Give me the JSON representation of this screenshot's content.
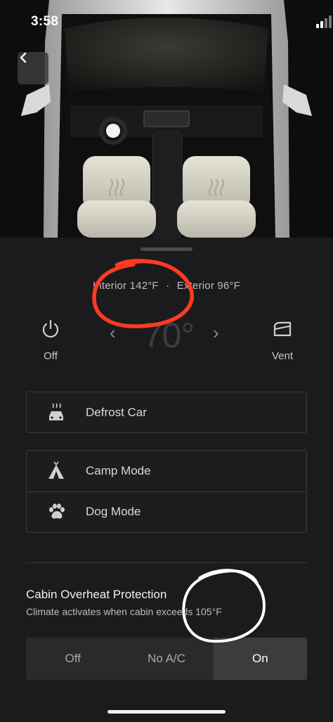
{
  "status": {
    "time": "3:58"
  },
  "nav": {
    "back_icon": "chevron-left-icon"
  },
  "climate": {
    "interior": "Interior 142°F",
    "separator": "·",
    "exterior": "Exterior 96°F",
    "setpoint": "70°",
    "power_label": "Off",
    "vent_label": "Vent"
  },
  "actions": {
    "defrost": {
      "label": "Defrost Car",
      "icon": "defrost-icon"
    },
    "camp": {
      "label": "Camp Mode",
      "icon": "tent-icon"
    },
    "dog": {
      "label": "Dog Mode",
      "icon": "paw-icon"
    }
  },
  "cabin_overheat": {
    "title": "Cabin Overheat Protection",
    "subtitle": "Climate activates when cabin exceeds 105°F",
    "options": [
      "Off",
      "No A/C",
      "On"
    ],
    "selected": "On"
  },
  "colors": {
    "panel": "#1b1b1d",
    "annotation_red": "#ff3b1f",
    "annotation_white": "#ffffff"
  }
}
